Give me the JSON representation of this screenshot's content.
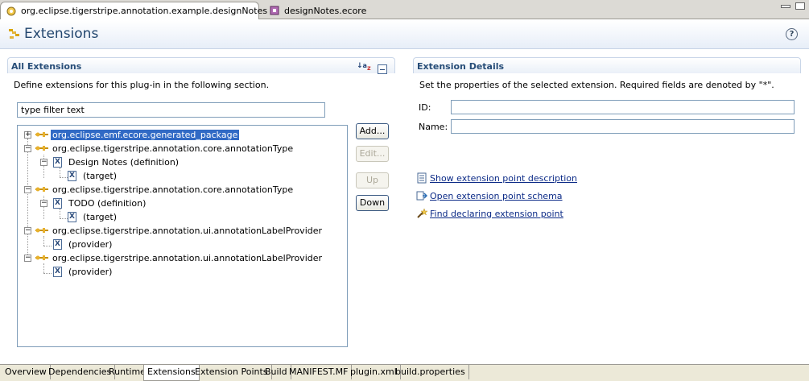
{
  "editor_tabs": [
    {
      "label": "org.eclipse.tigerstripe.annotation.example.designNotes",
      "close": "×"
    },
    {
      "label": "designNotes.ecore"
    }
  ],
  "header": {
    "title": "Extensions",
    "help": "?"
  },
  "all_extensions": {
    "title": "All Extensions",
    "description": "Define extensions for this plug-in in the following section.",
    "filter_value": "type filter text",
    "sort_icon": "az-sort-icon",
    "tree": [
      {
        "label": "org.eclipse.emf.ecore.generated_package",
        "level": 0,
        "type": "extension",
        "expander": "+",
        "selected": true
      },
      {
        "label": "org.eclipse.tigerstripe.annotation.core.annotationType",
        "level": 0,
        "type": "extension",
        "expander": "−"
      },
      {
        "label": "Design Notes (definition)",
        "level": 1,
        "type": "element",
        "expander": "−"
      },
      {
        "label": "(target)",
        "level": 2,
        "type": "element"
      },
      {
        "label": "org.eclipse.tigerstripe.annotation.core.annotationType",
        "level": 0,
        "type": "extension",
        "expander": "−"
      },
      {
        "label": "TODO (definition)",
        "level": 1,
        "type": "element",
        "expander": "−"
      },
      {
        "label": "(target)",
        "level": 2,
        "type": "element"
      },
      {
        "label": "org.eclipse.tigerstripe.annotation.ui.annotationLabelProvider",
        "level": 0,
        "type": "extension",
        "expander": "−"
      },
      {
        "label": "(provider)",
        "level": 1,
        "type": "element"
      },
      {
        "label": "org.eclipse.tigerstripe.annotation.ui.annotationLabelProvider",
        "level": 0,
        "type": "extension",
        "expander": "−"
      },
      {
        "label": "(provider)",
        "level": 1,
        "type": "element"
      }
    ],
    "buttons": {
      "add": "Add...",
      "edit": "Edit...",
      "up": "Up",
      "down": "Down"
    }
  },
  "extension_details": {
    "title": "Extension Details",
    "description": "Set the properties of the selected extension. Required fields are denoted by \"*\".",
    "id_label": "ID:",
    "name_label": "Name:",
    "links": [
      {
        "label": "Show extension point description",
        "icon": "document-icon"
      },
      {
        "label": "Open extension point schema",
        "icon": "schema-icon"
      },
      {
        "label": "Find declaring extension point",
        "icon": "search-wand-icon"
      }
    ]
  },
  "bottom_tabs": [
    "Overview",
    "Dependencies",
    "Runtime",
    "Extensions",
    "Extension Points",
    "Build",
    "MANIFEST.MF",
    "plugin.xml",
    "build.properties"
  ],
  "active_bottom_tab": "Extensions",
  "colors": {
    "section_title": "#274d78",
    "selection": "#316ac5",
    "link": "#0c2b87",
    "header_title": "#22466e"
  }
}
